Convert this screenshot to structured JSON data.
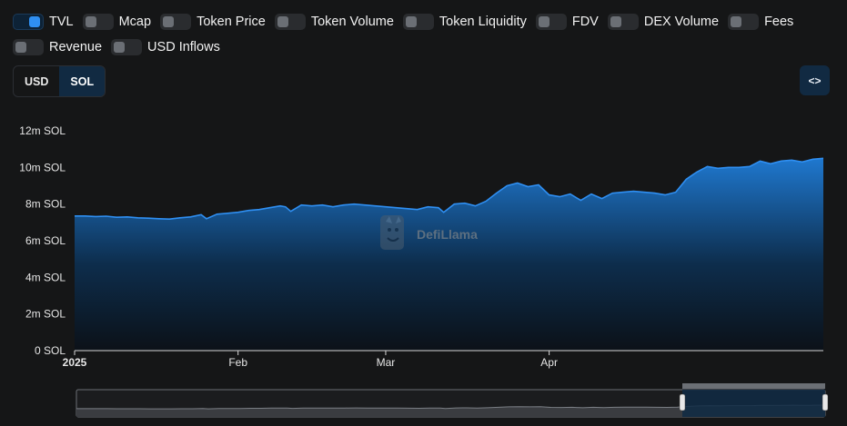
{
  "toggles": [
    {
      "label": "TVL",
      "on": true
    },
    {
      "label": "Mcap",
      "on": false
    },
    {
      "label": "Token Price",
      "on": false
    },
    {
      "label": "Token Volume",
      "on": false
    },
    {
      "label": "Token Liquidity",
      "on": false
    },
    {
      "label": "FDV",
      "on": false
    },
    {
      "label": "DEX Volume",
      "on": false
    },
    {
      "label": "Fees",
      "on": false
    },
    {
      "label": "Revenue",
      "on": false
    },
    {
      "label": "USD Inflows",
      "on": false
    }
  ],
  "currency": {
    "options": [
      "USD",
      "SOL"
    ],
    "selected": "SOL"
  },
  "embed_icon": "code-brackets-icon",
  "embed_label": "<>",
  "watermark": {
    "text": "DefiLlama",
    "icon": "llama-logo-icon"
  },
  "colors": {
    "background": "#151617",
    "line": "#2f8ff2",
    "accent": "#112a42"
  },
  "chart_data": {
    "type": "area",
    "ylim": [
      0,
      12000000
    ],
    "y_ticks": [
      {
        "value": 0,
        "label": "0 SOL"
      },
      {
        "value": 2000000,
        "label": "2m SOL"
      },
      {
        "value": 4000000,
        "label": "4m SOL"
      },
      {
        "value": 6000000,
        "label": "6m SOL"
      },
      {
        "value": 8000000,
        "label": "8m SOL"
      },
      {
        "value": 10000000,
        "label": "10m SOL"
      },
      {
        "value": 12000000,
        "label": "12m SOL"
      }
    ],
    "x_range": [
      "2025-01-01",
      "2025-04-30"
    ],
    "x_ticks": [
      {
        "date": "2025-01-01",
        "label": "2025",
        "bold": true
      },
      {
        "date": "2025-02-01",
        "label": "Feb",
        "bold": false
      },
      {
        "date": "2025-03-01",
        "label": "Mar",
        "bold": false
      },
      {
        "date": "2025-04-01",
        "label": "Apr",
        "bold": false
      }
    ],
    "series": [
      {
        "points": [
          [
            "2025-01-01",
            7350000
          ],
          [
            "2025-01-03",
            7350000
          ],
          [
            "2025-01-05",
            7320000
          ],
          [
            "2025-01-07",
            7340000
          ],
          [
            "2025-01-09",
            7280000
          ],
          [
            "2025-01-11",
            7300000
          ],
          [
            "2025-01-13",
            7250000
          ],
          [
            "2025-01-15",
            7230000
          ],
          [
            "2025-01-17",
            7200000
          ],
          [
            "2025-01-19",
            7180000
          ],
          [
            "2025-01-21",
            7250000
          ],
          [
            "2025-01-23",
            7300000
          ],
          [
            "2025-01-25",
            7420000
          ],
          [
            "2025-01-26",
            7200000
          ],
          [
            "2025-01-28",
            7450000
          ],
          [
            "2025-01-30",
            7500000
          ],
          [
            "2025-02-01",
            7550000
          ],
          [
            "2025-02-03",
            7650000
          ],
          [
            "2025-02-05",
            7700000
          ],
          [
            "2025-02-07",
            7800000
          ],
          [
            "2025-02-09",
            7900000
          ],
          [
            "2025-02-10",
            7850000
          ],
          [
            "2025-02-11",
            7600000
          ],
          [
            "2025-02-13",
            7950000
          ],
          [
            "2025-02-15",
            7900000
          ],
          [
            "2025-02-17",
            7950000
          ],
          [
            "2025-02-19",
            7850000
          ],
          [
            "2025-02-21",
            7950000
          ],
          [
            "2025-02-23",
            8000000
          ],
          [
            "2025-02-25",
            7950000
          ],
          [
            "2025-02-27",
            7900000
          ],
          [
            "2025-03-01",
            7850000
          ],
          [
            "2025-03-03",
            7800000
          ],
          [
            "2025-03-05",
            7750000
          ],
          [
            "2025-03-07",
            7700000
          ],
          [
            "2025-03-09",
            7850000
          ],
          [
            "2025-03-11",
            7800000
          ],
          [
            "2025-03-12",
            7550000
          ],
          [
            "2025-03-14",
            8000000
          ],
          [
            "2025-03-16",
            8050000
          ],
          [
            "2025-03-18",
            7900000
          ],
          [
            "2025-03-20",
            8150000
          ],
          [
            "2025-03-22",
            8600000
          ],
          [
            "2025-03-24",
            9000000
          ],
          [
            "2025-03-26",
            9150000
          ],
          [
            "2025-03-28",
            8950000
          ],
          [
            "2025-03-30",
            9050000
          ],
          [
            "2025-04-01",
            8500000
          ],
          [
            "2025-04-03",
            8400000
          ],
          [
            "2025-04-05",
            8550000
          ],
          [
            "2025-04-07",
            8200000
          ],
          [
            "2025-04-09",
            8550000
          ],
          [
            "2025-04-11",
            8300000
          ],
          [
            "2025-04-13",
            8600000
          ],
          [
            "2025-04-15",
            8650000
          ],
          [
            "2025-04-17",
            8700000
          ],
          [
            "2025-04-19",
            8650000
          ],
          [
            "2025-04-21",
            8600000
          ],
          [
            "2025-04-23",
            8500000
          ],
          [
            "2025-04-25",
            8650000
          ],
          [
            "2025-04-27",
            9350000
          ],
          [
            "2025-04-29",
            9750000
          ],
          [
            "2025-05-01",
            10050000
          ],
          [
            "2025-05-03",
            9950000
          ],
          [
            "2025-05-05",
            10000000
          ],
          [
            "2025-05-07",
            10000000
          ],
          [
            "2025-05-09",
            10050000
          ],
          [
            "2025-05-11",
            10350000
          ],
          [
            "2025-05-13",
            10200000
          ],
          [
            "2025-05-15",
            10350000
          ],
          [
            "2025-05-17",
            10400000
          ],
          [
            "2025-05-19",
            10300000
          ],
          [
            "2025-05-21",
            10450000
          ],
          [
            "2025-05-23",
            10500000
          ]
        ]
      }
    ],
    "brush": {
      "start": "2025-01-01",
      "end": "2025-05-23",
      "selected_start": "2025-05-23"
    }
  }
}
